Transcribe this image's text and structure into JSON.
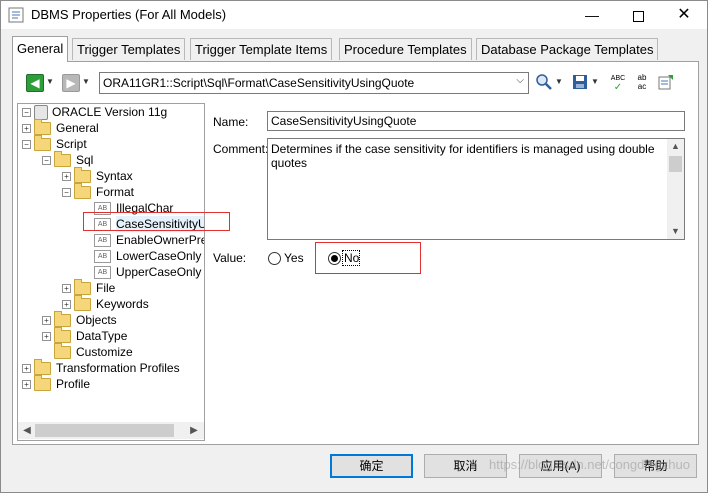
{
  "window": {
    "title": "DBMS Properties (For All Models)",
    "controls": {
      "minimize": "—",
      "close": "✕"
    }
  },
  "tabs": [
    {
      "label": "General",
      "active": true
    },
    {
      "label": "Trigger Templates"
    },
    {
      "label": "Trigger Template Items"
    },
    {
      "label": "Procedure Templates"
    },
    {
      "label": "Database Package Templates"
    }
  ],
  "toolbar": {
    "path": "ORA11GR1::Script\\Sql\\Format\\CaseSensitivityUsingQuote",
    "icons": [
      "back-arrow-icon",
      "forward-arrow-icon",
      "search-icon",
      "save-icon",
      "spellcheck-icon",
      "replace-icon",
      "properties-icon"
    ],
    "spell_text": "ABC",
    "replace_text": "ab ac"
  },
  "tree": {
    "root": "ORACLE Version 11g",
    "items": [
      {
        "label": "General"
      },
      {
        "label": "Script"
      },
      {
        "label": "Sql"
      },
      {
        "label": "Syntax"
      },
      {
        "label": "Format"
      },
      {
        "label": "IllegalChar"
      },
      {
        "label": "CaseSensitivityU"
      },
      {
        "label": "EnableOwnerPre"
      },
      {
        "label": "LowerCaseOnly"
      },
      {
        "label": "UpperCaseOnly"
      },
      {
        "label": "File"
      },
      {
        "label": "Keywords"
      },
      {
        "label": "Objects"
      },
      {
        "label": "DataType"
      },
      {
        "label": "Customize"
      },
      {
        "label": "Transformation Profiles"
      },
      {
        "label": "Profile"
      }
    ],
    "item_icon_text": "AB"
  },
  "properties": {
    "name_label": "Name:",
    "name_value": "CaseSensitivityUsingQuote",
    "comment_label": "Comment:",
    "comment_value": "Determines if the case sensitivity for identifiers is managed using double quotes",
    "value_label": "Value:",
    "options": [
      {
        "label": "Yes",
        "checked": false
      },
      {
        "label": "No",
        "checked": true
      }
    ]
  },
  "buttons": {
    "ok": "确定",
    "cancel": "取消",
    "apply": "应用(A)",
    "help": "帮助"
  },
  "watermark": "https://blog.csdn.net/congdingzhuo",
  "colors": {
    "highlight_box": "#e03030",
    "default_button_border": "#0078d7"
  }
}
